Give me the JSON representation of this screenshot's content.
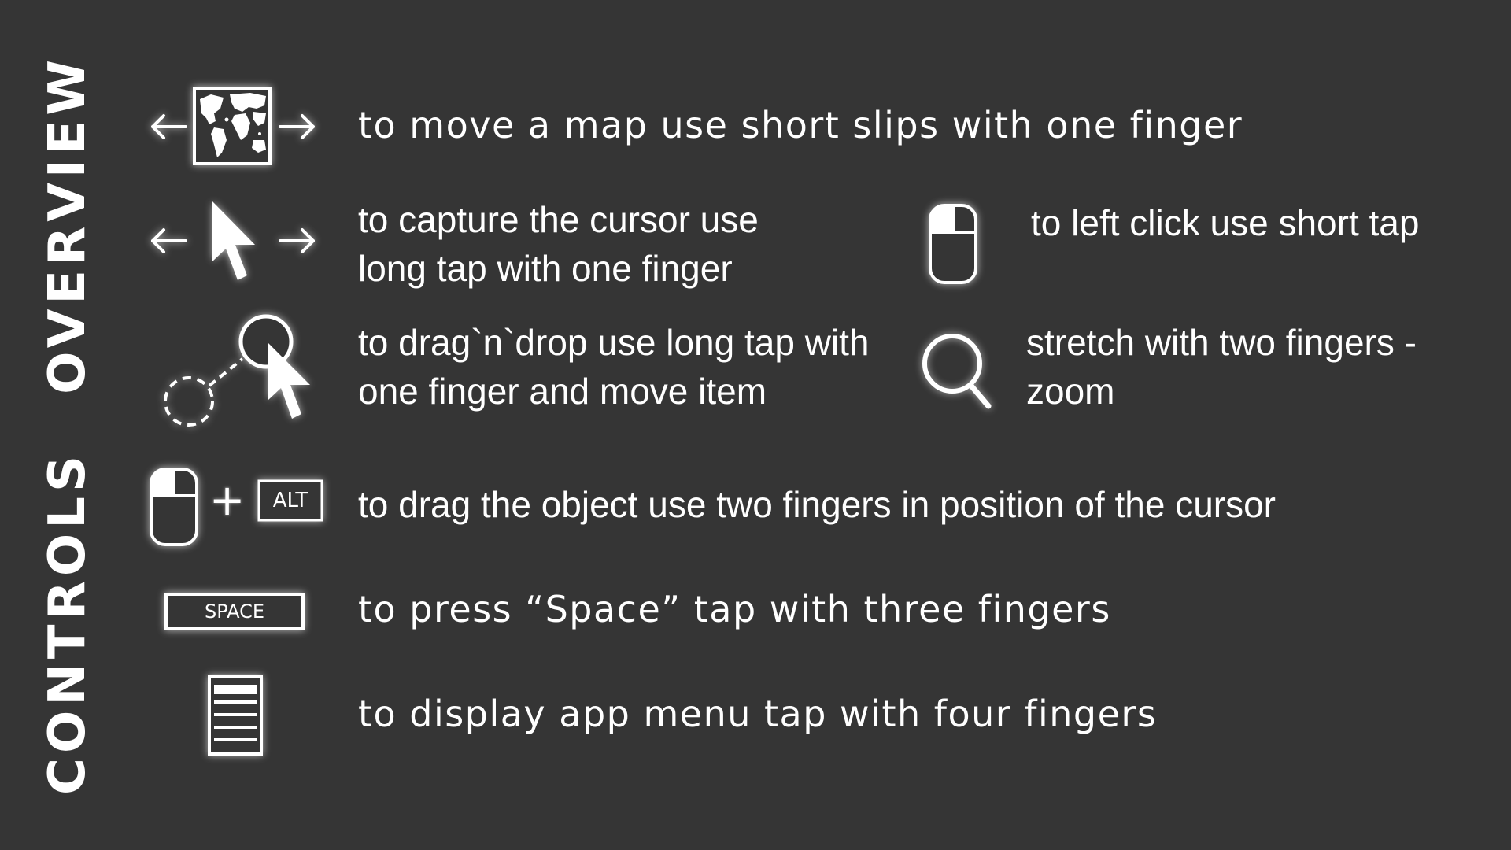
{
  "title": {
    "word1": "CONTROLS",
    "word2": "OVERVIEW"
  },
  "icons": {
    "move_map": "world-map-arrows-icon",
    "capture_cursor": "cursor-arrows-icon",
    "drag_drop": "drag-drop-cursor-icon",
    "left_click": "mouse-left-button-icon",
    "zoom": "magnifier-icon",
    "drag_object": "mouse-plus-alt-icon",
    "space": "space-key-icon",
    "menu": "menu-document-icon"
  },
  "keys": {
    "alt": "ALT",
    "space": "SPACE",
    "plus": "+"
  },
  "instructions": {
    "move_map": "to move a map use short slips with one finger",
    "capture_cursor_line1": "to capture the cursor use",
    "capture_cursor_line2": "long tap with one finger",
    "left_click": "to left click use short tap",
    "drag_drop_line1": "to drag`n`drop use long tap with",
    "drag_drop_line2": "one finger and move item",
    "zoom_line1": "stretch with two fingers -",
    "zoom_line2": "zoom",
    "drag_object": "to drag the object use two fingers in position of the cursor",
    "space": "to press “Space” tap with three fingers",
    "menu": "to display app menu tap with four fingers"
  },
  "colors": {
    "background": "#353535",
    "foreground": "#ffffff"
  }
}
